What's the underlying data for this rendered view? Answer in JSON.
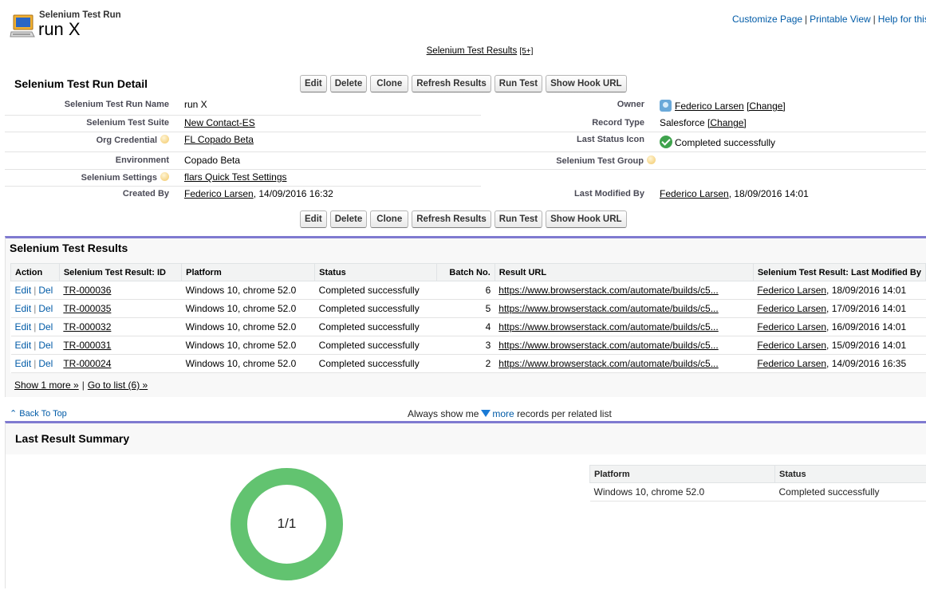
{
  "header": {
    "record_type": "Selenium Test Run",
    "title": "run X",
    "links": [
      "Customize Page",
      "Printable View",
      "Help for this Pag"
    ],
    "related_hover_link": "Selenium Test Results",
    "related_hover_count": "[5+]"
  },
  "detail": {
    "section_title": "Selenium Test Run Detail",
    "buttons": [
      "Edit",
      "Delete",
      "Clone",
      "Refresh Results",
      "Run Test",
      "Show Hook URL"
    ],
    "left_fields": [
      {
        "label": "Selenium Test Run Name",
        "value": "run X"
      },
      {
        "label": "Selenium Test Suite",
        "value": "New Contact-ES"
      },
      {
        "label": "Org Credential",
        "value": "FL Copado Beta"
      },
      {
        "label": "Environment",
        "value": "Copado Beta"
      },
      {
        "label": "Selenium Settings",
        "value": "flars Quick Test Settings"
      },
      {
        "label": "Created By",
        "value_link": "Federico Larsen",
        "value_rest": ", 14/09/2016 16:32"
      }
    ],
    "right_fields": [
      {
        "label": "Owner",
        "value_link": "Federico Larsen",
        "change": "[Change]"
      },
      {
        "label": "Record Type",
        "value": "Salesforce",
        "change": "[Change]"
      },
      {
        "label": "Last Status Icon",
        "value": "Completed successfully"
      },
      {
        "label": "Selenium Test Group",
        "value": ""
      },
      {
        "label": "Last Modified By",
        "value_link": "Federico Larsen",
        "value_rest": ", 18/09/2016 14:01"
      }
    ]
  },
  "results": {
    "title": "Selenium Test Results",
    "columns": [
      "Action",
      "Selenium Test Result: ID",
      "Platform",
      "Status",
      "Batch No.",
      "Result URL",
      "Selenium Test Result: Last Modified By"
    ],
    "action_edit": "Edit",
    "action_del": "Del",
    "rows": [
      {
        "id": "TR-000036",
        "platform": "Windows 10, chrome 52.0",
        "status": "Completed successfully",
        "batch": "6",
        "url": "https://www.browserstack.com/automate/builds/c5...",
        "modified_by": "Federico Larsen",
        "modified_date": ", 18/09/2016 14:01"
      },
      {
        "id": "TR-000035",
        "platform": "Windows 10, chrome 52.0",
        "status": "Completed successfully",
        "batch": "5",
        "url": "https://www.browserstack.com/automate/builds/c5...",
        "modified_by": "Federico Larsen",
        "modified_date": ", 17/09/2016 14:01"
      },
      {
        "id": "TR-000032",
        "platform": "Windows 10, chrome 52.0",
        "status": "Completed successfully",
        "batch": "4",
        "url": "https://www.browserstack.com/automate/builds/c5...",
        "modified_by": "Federico Larsen",
        "modified_date": ", 16/09/2016 14:01"
      },
      {
        "id": "TR-000031",
        "platform": "Windows 10, chrome 52.0",
        "status": "Completed successfully",
        "batch": "3",
        "url": "https://www.browserstack.com/automate/builds/c5...",
        "modified_by": "Federico Larsen",
        "modified_date": ", 15/09/2016 14:01"
      },
      {
        "id": "TR-000024",
        "platform": "Windows 10, chrome 52.0",
        "status": "Completed successfully",
        "batch": "2",
        "url": "https://www.browserstack.com/automate/builds/c5...",
        "modified_by": "Federico Larsen",
        "modified_date": ", 14/09/2016 16:35"
      }
    ],
    "show_more": "Show 1 more »",
    "go_to_list": "Go to list (6) »"
  },
  "footer_nav": {
    "back_to_top": "Back To Top",
    "always_show_prefix": "Always show me",
    "more_link": "more",
    "always_show_suffix": "records per related list"
  },
  "summary": {
    "title": "Last Result Summary",
    "donut_label": "1/1",
    "donut_color": "#62c370",
    "passed_fraction": 1.0,
    "columns": [
      "Platform",
      "Status"
    ],
    "rows": [
      {
        "platform": "Windows 10, chrome 52.0",
        "status": "Completed successfully"
      }
    ]
  },
  "colors": {
    "accent_border": "#7f7ad0",
    "link_blue": "#015ba7"
  },
  "icons": {
    "record_icon": "computer-icon",
    "status_ok": "check-circle-icon",
    "help": "help-bubble-icon",
    "owner": "user-avatar-icon",
    "more_dropdown": "triangle-down-icon"
  }
}
